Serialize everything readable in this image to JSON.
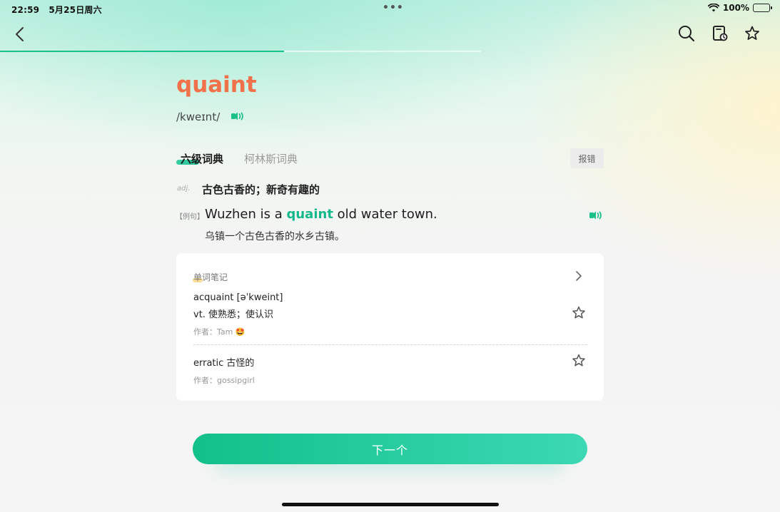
{
  "status": {
    "time": "22:59",
    "date": "5月25日周六",
    "dots": "•••",
    "battery": "100%"
  },
  "nav": {
    "back_icon": "chevron-left-icon",
    "search_icon": "search-icon",
    "notebook_icon": "notebook-add-icon",
    "favorite_icon": "star-icon",
    "progress": 0.59
  },
  "word": {
    "text": "quaint",
    "phonetic": "/kweɪnt/",
    "speaker_icon": "speaker-icon"
  },
  "tabs": {
    "items": [
      {
        "label": "六级词典",
        "active": true
      },
      {
        "label": "柯林斯词典",
        "active": false
      }
    ],
    "report_label": "报错"
  },
  "definition": {
    "pos": "adj.",
    "meaning": "古色古香的；新奇有趣的"
  },
  "example": {
    "tag": "【例句】",
    "before": "Wuzhen is a ",
    "highlight": "quaint",
    "after": " old water town.",
    "translation": "乌镇一个古色古香的水乡古镇。"
  },
  "notes": {
    "title": "单词笔记",
    "items": [
      {
        "line1": "acquaint [əˈkweint]",
        "line2": "vt. 使熟悉；使认识",
        "author_label": "作者：",
        "author": "Tam 🤩"
      },
      {
        "line1": "erratic 古怪的",
        "author_label": "作者：",
        "author": "gossipgirl"
      }
    ]
  },
  "next_button": {
    "label": "下一个"
  },
  "colors": {
    "accent": "#14b88b",
    "word": "#f0714a"
  }
}
